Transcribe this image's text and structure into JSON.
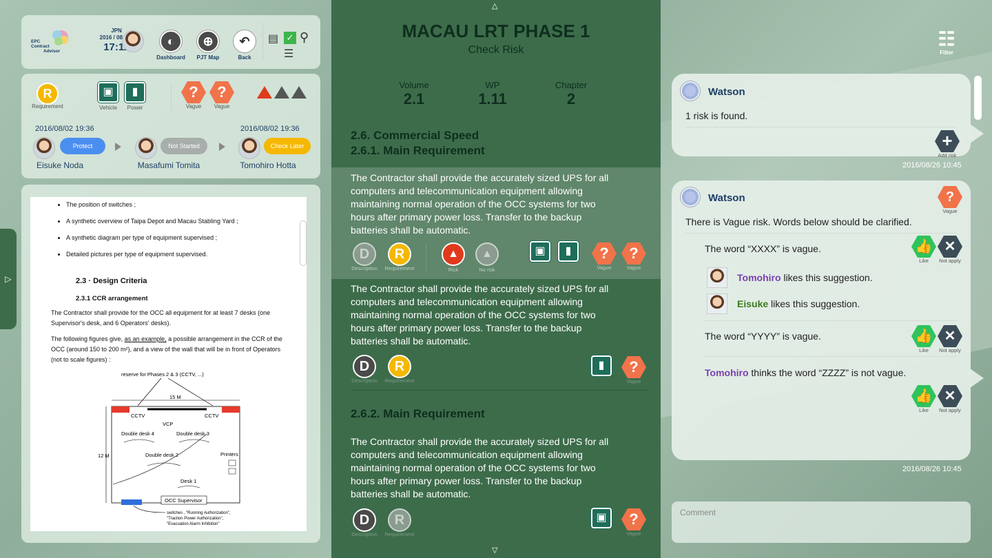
{
  "header": {
    "logo_lines": [
      "EPC",
      "Contract",
      "Advisor"
    ],
    "country": "JPN",
    "date": "2016 / 08 / 02",
    "time": "17:11",
    "nav": [
      {
        "label": "Dashboard",
        "icon": "dashboard-icon"
      },
      {
        "label": "PJT Map",
        "icon": "globe-icon"
      },
      {
        "label": "Back",
        "icon": "back-icon"
      }
    ]
  },
  "status": {
    "requirement_label": "Requirement",
    "requirement_letter": "R",
    "vehicle_label": "Vehicle",
    "power_label": "Power",
    "vague_label": "Vague",
    "vague_symbol": "?",
    "workflow": [
      {
        "date": "2016/08/02 19:36",
        "name": "Eisuke Noda",
        "state": "Protect",
        "color": "#4a8ff0"
      },
      {
        "date": "",
        "name": "Masafumi Tomita",
        "state": "Not Started",
        "color": "#a8aeab"
      },
      {
        "date": "2016/08/02 19:36",
        "name": "Tomohiro Hotta",
        "state": "Check Later",
        "color": "#f5b800"
      }
    ]
  },
  "document": {
    "bullets": [
      "The position of switches ;",
      "A synthetic overview of Taipa Depot and Macau Stabling Yard ;",
      "A synthetic diagram per type of equipment supervised ;",
      "Detailed pictures per type of equipment supervised."
    ],
    "h3": "2.3 · Design Criteria",
    "h4": "2.3.1 CCR arrangement",
    "p1": "The Contractor shall provide for the OCC all equipment for at least 7 desks (one Supervisor's desk, and 6 Operators' desks).",
    "p2a": "The following figures give, ",
    "p2b": "as an example,",
    "p2c": " a possible arrangement in the CCR of the OCC (around 150 to 200 m²), and a view of the wall that will be in front of Operators (not to scale figures) :",
    "diagram": {
      "reserve": "reserve for Phases 2 & 3 (CCTV, ...)",
      "width": "15 M",
      "height": "12 M",
      "cctv_left": "CCTV",
      "cctv_right": "CCTV",
      "vcp": "VCP",
      "desk4": "Double desk 4",
      "desk3": "Double desk 3",
      "desk2": "Double desk 2",
      "desk1": "Desk 1",
      "printers": "Printers",
      "supervisor": "OCC Supervisor",
      "note1": "switches , \"Running Authorization\",",
      "note2": "\"Traction Power Authorization\",",
      "note3": "\"Evacuation Alarm Inhibition\""
    }
  },
  "middle": {
    "title": "MACAU LRT PHASE 1",
    "subtitle": "Check Risk",
    "volume_label": "Volume",
    "volume": "2.1",
    "wp_label": "WP",
    "wp": "1.11",
    "chapter_label": "Chapter",
    "chapter": "2",
    "sec1": "2.6. Commercial Speed",
    "sec2": "2.6.1. Main Requirement",
    "sec3": "2.6.2. Main Requirement",
    "para": "The Contractor shall provide the accurately sized UPS for all computers and telecommunication equipment allowing maintaining normal operation of the OCC systems for two hours after primary power loss. Transfer to the backup batteries shall be automatic.",
    "description_label": "Description",
    "requirement_label": "Requirement",
    "risk_label": "Risk",
    "norisk_label": "No risk",
    "vague_label": "Vague",
    "letter_d": "D",
    "letter_r": "R"
  },
  "right": {
    "filter_label": "Filter",
    "msg1": {
      "author": "Watson",
      "text": "1 risk is found.",
      "add_label": "Add risk",
      "time": "2016/08/26 10:45"
    },
    "msg2": {
      "author": "Watson",
      "vague_label": "Vague",
      "text": "There is Vague risk. Words below should be clarified.",
      "word1": "The word “XXXX” is vague.",
      "like1_name": "Tomohiro",
      "like1_rest": " likes this suggestion.",
      "like2_name": "Eisuke",
      "like2_rest": " likes this suggestion.",
      "word2": "The word “YYYY” is vague.",
      "think_name": "Tomohiro",
      "think_rest": " thinks the word “ZZZZ” is not vague.",
      "like_label": "Like",
      "notapply_label": "Not apply",
      "time": "2016/08/26 10:45"
    },
    "comment_placeholder": "Comment"
  },
  "colors": {
    "panel": "#3d6c4b",
    "accent_orange": "#f1734a",
    "accent_yellow": "#f5b800",
    "like_green": "#2fc35c",
    "navy": "#1d3f66"
  }
}
